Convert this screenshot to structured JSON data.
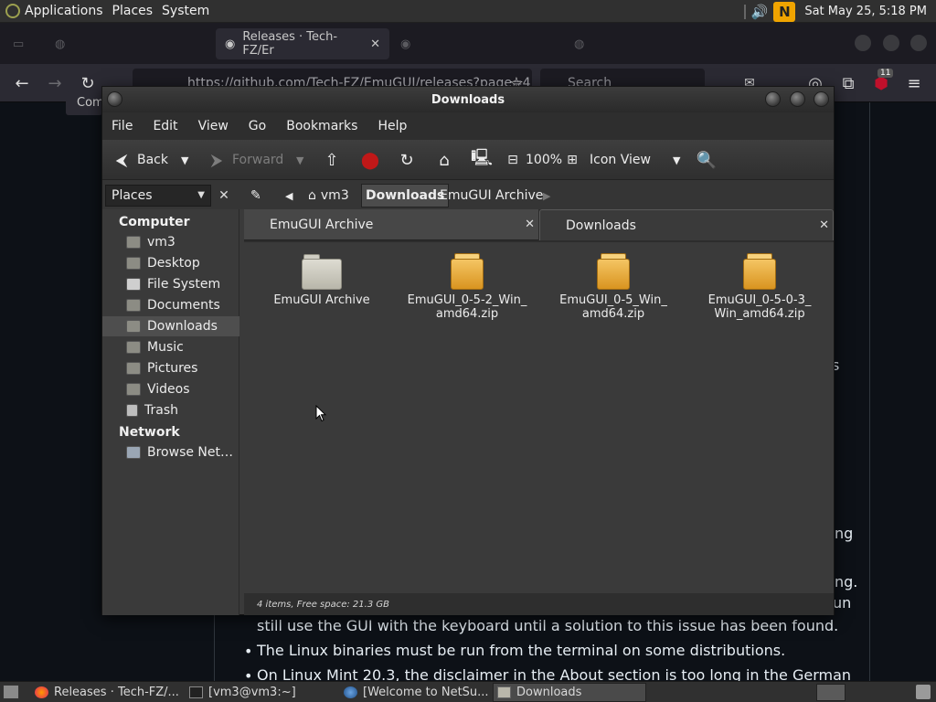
{
  "top_panel": {
    "menus": [
      "Applications",
      "Places",
      "System"
    ],
    "clock": "Sat May 25,  5:18 PM"
  },
  "browser": {
    "tabs": [
      {
        "label": "Releases · Tech-FZ/Er",
        "active": true
      }
    ],
    "url": "https://github.com/Tech-FZ/EmuGUI/releases?page=4",
    "search_placeholder": "Search",
    "extension_badge": "11",
    "tooltip_fragment": "Com",
    "page_text": {
      "line1": "still use the GUI with the keyboard until a solution to this issue has been found.",
      "line2": "The Linux binaries must be run from the terminal on some distributions.",
      "line3": "On Linux Mint 20.3, the disclaimer in the About section is too long in the German",
      "frag_s": "s",
      "frag_ng": "ng",
      "frag_ng2": "ng.",
      "frag_un": "un"
    }
  },
  "file_manager": {
    "title": "Downloads",
    "menu": [
      "File",
      "Edit",
      "View",
      "Go",
      "Bookmarks",
      "Help"
    ],
    "toolbar": {
      "back": "Back",
      "forward": "Forward",
      "zoom": "100%",
      "view_mode": "Icon View"
    },
    "places_combo": "Places",
    "breadcrumbs": [
      "vm3",
      "Downloads",
      "EmuGUI Archive"
    ],
    "sidebar": {
      "computer_heading": "Computer",
      "computer_items": [
        "vm3",
        "Desktop",
        "File System",
        "Documents",
        "Downloads",
        "Music",
        "Pictures",
        "Videos",
        "Trash"
      ],
      "network_heading": "Network",
      "network_items": [
        "Browse Net…"
      ]
    },
    "tabs": [
      {
        "label": "EmuGUI Archive",
        "active": false
      },
      {
        "label": "Downloads",
        "active": true
      }
    ],
    "files": [
      {
        "name": "EmuGUI Archive",
        "kind": "folder-icon"
      },
      {
        "name": "EmuGUI_0-5-2_Win_ amd64.zip",
        "kind": "package-icon"
      },
      {
        "name": "EmuGUI_0-5_Win_ amd64.zip",
        "kind": "package-icon"
      },
      {
        "name": "EmuGUI_0-5-0-3_ Win_amd64.zip",
        "kind": "package-icon"
      }
    ],
    "status": "4 items, Free space: 21.3 GB"
  },
  "taskbar": {
    "items": [
      {
        "label": "Releases · Tech-FZ/...",
        "active": false
      },
      {
        "label": "[vm3@vm3:~]",
        "active": false
      },
      {
        "label": "[Welcome to NetSu...",
        "active": false
      },
      {
        "label": "Downloads",
        "active": true
      }
    ]
  }
}
